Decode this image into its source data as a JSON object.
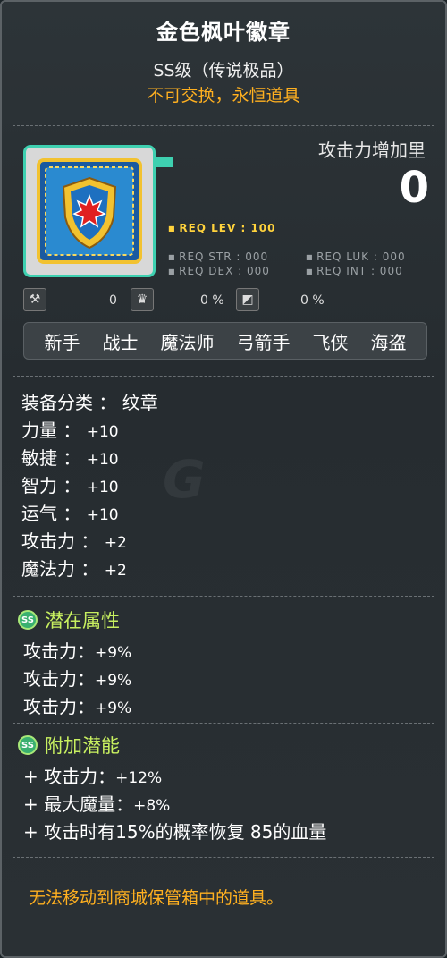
{
  "item": {
    "name": "金色枫叶徽章",
    "grade": "SS级（传说极品）",
    "trade": "不可交换，永恒道具"
  },
  "attack_increase": {
    "label": "攻击力增加里",
    "value": "0"
  },
  "requirements": {
    "lev": "REQ LEV : 100",
    "str": "REQ STR : 000",
    "luk": "REQ LUK : 000",
    "dex": "REQ DEX : 000",
    "int": "REQ INT : 000"
  },
  "mini_stats": {
    "a": "0",
    "b": "0 %",
    "c": "0 %"
  },
  "jobs": [
    "新手",
    "战士",
    "魔法师",
    "弓箭手",
    "飞侠",
    "海盗"
  ],
  "stats": [
    {
      "label": "装备分类 ： 纹章",
      "value": ""
    },
    {
      "label": "力量 ：",
      "value": "+10"
    },
    {
      "label": "敏捷 ：",
      "value": "+10"
    },
    {
      "label": "智力 ：",
      "value": "+10"
    },
    {
      "label": "运气 ：",
      "value": "+10"
    },
    {
      "label": "攻击力 ：",
      "value": "+2"
    },
    {
      "label": "魔法力 ：",
      "value": "+2"
    }
  ],
  "potential": {
    "title": "潜在属性",
    "badge": "SS",
    "lines": [
      {
        "label": "攻击力：",
        "value": "+9%"
      },
      {
        "label": "攻击力：",
        "value": "+9%"
      },
      {
        "label": "攻击力：",
        "value": "+9%"
      }
    ]
  },
  "bonus_potential": {
    "title": "附加潜能",
    "badge": "SS",
    "lines": [
      {
        "label": "+ 攻击力：",
        "value": "+12%"
      },
      {
        "label": "+ 最大魔量：",
        "value": "+8%"
      },
      {
        "label": "+ 攻击时有15%的概率恢复 85的血量",
        "value": ""
      }
    ]
  },
  "footer": "无法移动到商城保管箱中的道具。",
  "colors": {
    "gold": "#ffb020",
    "teal": "#3ed0b0",
    "potential": "#c8f060"
  }
}
